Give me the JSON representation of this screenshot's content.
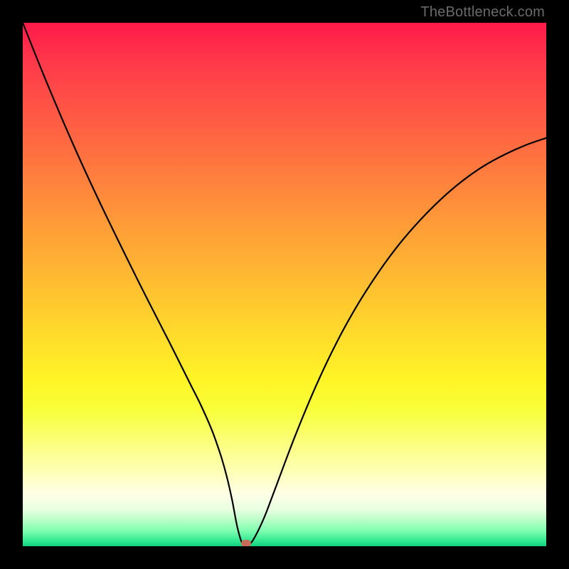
{
  "watermark": "TheBottleneck.com",
  "colors": {
    "frame": "#000000",
    "curve": "#000000",
    "marker": "#c96a5a"
  },
  "chart_data": {
    "type": "line",
    "title": "",
    "xlabel": "",
    "ylabel": "",
    "xlim": [
      0,
      100
    ],
    "ylim": [
      0,
      100
    ],
    "grid": false,
    "series": [
      {
        "name": "bottleneck-curve",
        "x": [
          0,
          4,
          8,
          12,
          16,
          20,
          24,
          28,
          32,
          34,
          36,
          37,
          38,
          39,
          40,
          41,
          42,
          43,
          44,
          46,
          48,
          52,
          56,
          60,
          64,
          68,
          72,
          76,
          80,
          84,
          88,
          92,
          96,
          100
        ],
        "y": [
          100,
          90,
          80.5,
          71.5,
          63,
          54.8,
          46.8,
          39,
          31,
          27,
          22.5,
          19.8,
          16.8,
          13.2,
          8.8,
          3.6,
          0.4,
          0.4,
          1.2,
          5.2,
          10.4,
          21,
          30.6,
          39,
          46.2,
          52.4,
          57.8,
          62.4,
          66.4,
          69.8,
          72.6,
          74.8,
          76.6,
          78
        ]
      }
    ],
    "marker": {
      "x": 42.6,
      "y": 0.6
    }
  }
}
